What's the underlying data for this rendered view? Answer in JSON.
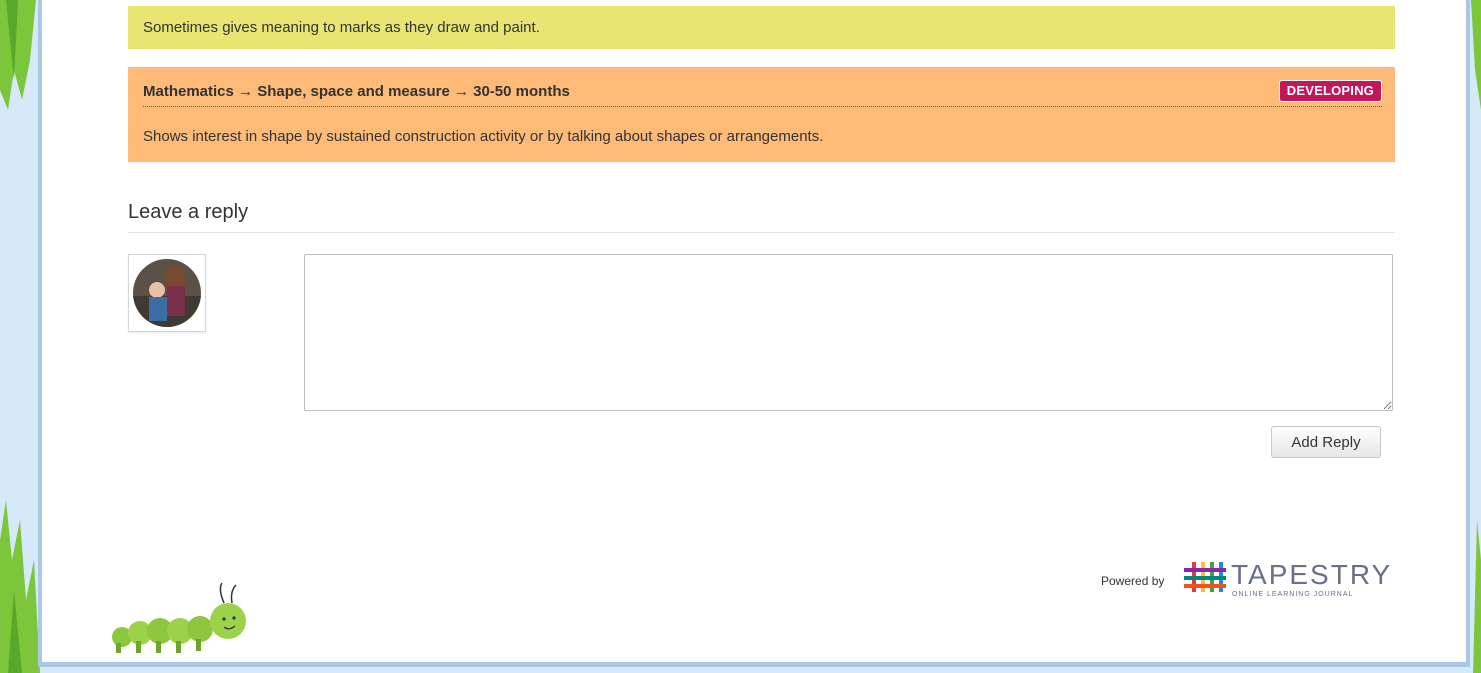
{
  "observations": [
    {
      "text": "Sometimes gives meaning to marks as they draw and paint.",
      "color": "#e9e572"
    },
    {
      "heading": "Mathematics → Shape, space and measure → 30-50 months",
      "badge": "DEVELOPING",
      "badge_color": "#c2185b",
      "text": "Shows interest in shape by sustained construction activity or by talking about shapes or arrangements.",
      "color": "#fdbb77"
    }
  ],
  "reply": {
    "title": "Leave a reply",
    "textarea_value": "",
    "button_label": "Add Reply"
  },
  "footer": {
    "powered_by": "Powered by",
    "brand": "TAPESTRY",
    "brand_tagline": "ONLINE LEARNING JOURNAL"
  }
}
